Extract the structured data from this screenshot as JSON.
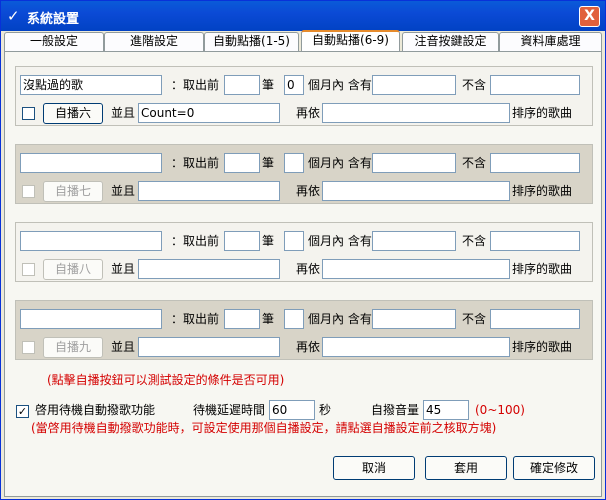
{
  "window": {
    "title": "系統設置",
    "close": "X"
  },
  "tabs": [
    "一般設定",
    "進階設定",
    "自動點播(1-5)",
    "自動點播(6-9)",
    "注音按鍵設定",
    "資料庫處理"
  ],
  "labels": {
    "take_prefix": "：取出前",
    "pen": "筆",
    "months": "個月內 含有",
    "exclude": "不含",
    "and": "並且",
    "then_by": "再依",
    "sorted": "排序的歌曲"
  },
  "groups": [
    {
      "name": "沒點過的歌",
      "count": "",
      "months": "0",
      "include": "",
      "exclude": "",
      "button": "自播六",
      "condition": "Count=0",
      "sort": "",
      "enabled": true
    },
    {
      "name": "",
      "count": "",
      "months": "",
      "include": "",
      "exclude": "",
      "button": "自播七",
      "condition": "",
      "sort": "",
      "enabled": false
    },
    {
      "name": "",
      "count": "",
      "months": "",
      "include": "",
      "exclude": "",
      "button": "自播八",
      "condition": "",
      "sort": "",
      "enabled": false
    },
    {
      "name": "",
      "count": "",
      "months": "",
      "include": "",
      "exclude": "",
      "button": "自播九",
      "condition": "",
      "sort": "",
      "enabled": false
    }
  ],
  "hint1": "(點擊自播按鈕可以測試設定的條件是否可用)",
  "standby": {
    "checkbox_label": "啓用待機自動撥歌功能",
    "delay_label": "待機延遲時間",
    "delay_value": "60",
    "delay_unit": "秒",
    "volume_label": "自撥音量",
    "volume_value": "45",
    "volume_range": "(0~100)"
  },
  "hint2": "(當啓用待機自動撥歌功能時，可設定使用那個自播設定，請點選自播設定前之核取方塊)",
  "buttons": {
    "cancel": "取消",
    "apply": "套用",
    "confirm": "確定修改"
  }
}
